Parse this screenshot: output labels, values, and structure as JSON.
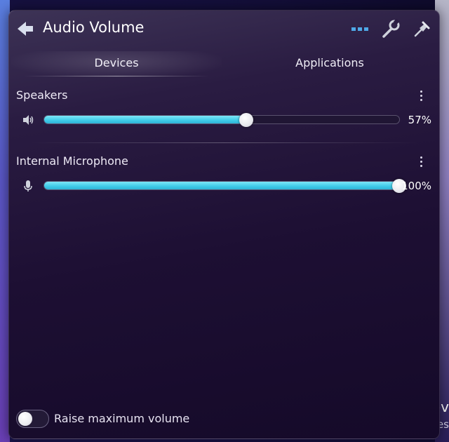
{
  "panel": {
    "title": "Audio Volume",
    "icons": {
      "back": "back-arrow-icon",
      "more": "horizontal-ellipsis-icon",
      "configure": "wrench-icon",
      "pin": "pin-icon"
    }
  },
  "tabs": [
    {
      "label": "Devices",
      "active": true
    },
    {
      "label": "Applications",
      "active": false
    }
  ],
  "devices": [
    {
      "name": "Speakers",
      "icon": "speaker-icon",
      "volume_percent": 57,
      "volume_label": "57%"
    },
    {
      "name": "Internal Microphone",
      "icon": "microphone-icon",
      "volume_percent": 100,
      "volume_label": "100%"
    }
  ],
  "footer": {
    "raise_max_label": "Raise maximum volume",
    "raise_max_enabled": false
  },
  "background": {
    "text_line_1": "ev",
    "text_line_2": "es"
  },
  "colors": {
    "accent": "#3ecbe8",
    "panel_bg": "#1d0f33",
    "text": "#ffffff"
  }
}
